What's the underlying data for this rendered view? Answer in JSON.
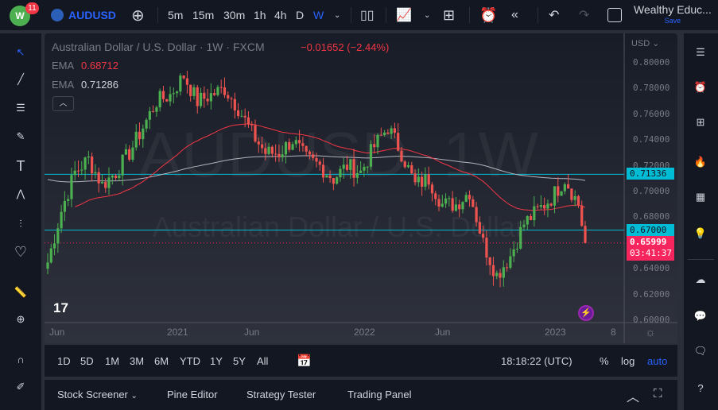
{
  "topbar": {
    "badge": "11",
    "symbol": "AUDUSD",
    "intervals": [
      "5m",
      "15m",
      "30m",
      "1h",
      "4h",
      "D",
      "W"
    ],
    "active_interval": "W",
    "layout_name": "Wealthy Educ...",
    "save": "Save"
  },
  "legend": {
    "title": "Australian Dollar / U.S. Dollar · 1W · FXCM",
    "change": "−0.01652 (−2.44%)",
    "ema1_label": "EMA",
    "ema1_value": "0.68712",
    "ema2_label": "EMA",
    "ema2_value": "0.71286"
  },
  "watermark": {
    "symbol": "AUDUSD, 1W",
    "name": "Australian Dollar / U.S. Dollar"
  },
  "price_axis": {
    "currency": "USD",
    "ticks": [
      "0.80000",
      "0.78000",
      "0.76000",
      "0.74000",
      "0.72000",
      "0.70000",
      "0.68000",
      "0.66000",
      "0.64000",
      "0.62000",
      "0.60000"
    ],
    "line1": "0.71336",
    "line2": "0.67000",
    "last_price": "0.65999",
    "countdown": "03:41:37"
  },
  "time_axis": [
    "Jun",
    "2021",
    "Jun",
    "2022",
    "Jun",
    "2023",
    "8"
  ],
  "bottombar": {
    "ranges": [
      "1D",
      "5D",
      "1M",
      "3M",
      "6M",
      "YTD",
      "1Y",
      "5Y",
      "All"
    ],
    "clock": "18:18:22 (UTC)",
    "pct": "%",
    "log": "log",
    "auto": "auto"
  },
  "panel": {
    "tabs": [
      "Stock Screener",
      "Pine Editor",
      "Strategy Tester",
      "Trading Panel"
    ]
  },
  "colors": {
    "up": "#26a69a",
    "up_bright": "#4caf50",
    "down": "#ef5350",
    "ema50": "#f23645",
    "ema200": "#b2b5be",
    "hline": "#00bcd4",
    "last": "#f7255e",
    "accent": "#2962ff"
  },
  "chart_data": {
    "type": "candlestick",
    "title": "AUDUSD 1W",
    "ylim": [
      0.6,
      0.8
    ],
    "anchors": [
      [
        0,
        0.645
      ],
      [
        4,
        0.685
      ],
      [
        8,
        0.715
      ],
      [
        12,
        0.725
      ],
      [
        16,
        0.705
      ],
      [
        20,
        0.715
      ],
      [
        24,
        0.73
      ],
      [
        28,
        0.75
      ],
      [
        32,
        0.77
      ],
      [
        36,
        0.775
      ],
      [
        40,
        0.79
      ],
      [
        44,
        0.77
      ],
      [
        48,
        0.775
      ],
      [
        52,
        0.78
      ],
      [
        56,
        0.765
      ],
      [
        60,
        0.745
      ],
      [
        64,
        0.73
      ],
      [
        68,
        0.73
      ],
      [
        72,
        0.74
      ],
      [
        76,
        0.725
      ],
      [
        80,
        0.72
      ],
      [
        84,
        0.71
      ],
      [
        88,
        0.72
      ],
      [
        92,
        0.715
      ],
      [
        96,
        0.735
      ],
      [
        100,
        0.75
      ],
      [
        104,
        0.73
      ],
      [
        108,
        0.705
      ],
      [
        112,
        0.71
      ],
      [
        116,
        0.69
      ],
      [
        120,
        0.69
      ],
      [
        124,
        0.7
      ],
      [
        128,
        0.66
      ],
      [
        132,
        0.635
      ],
      [
        136,
        0.65
      ],
      [
        140,
        0.675
      ],
      [
        144,
        0.685
      ],
      [
        148,
        0.695
      ],
      [
        152,
        0.71
      ],
      [
        156,
        0.69
      ],
      [
        158,
        0.66
      ]
    ]
  }
}
